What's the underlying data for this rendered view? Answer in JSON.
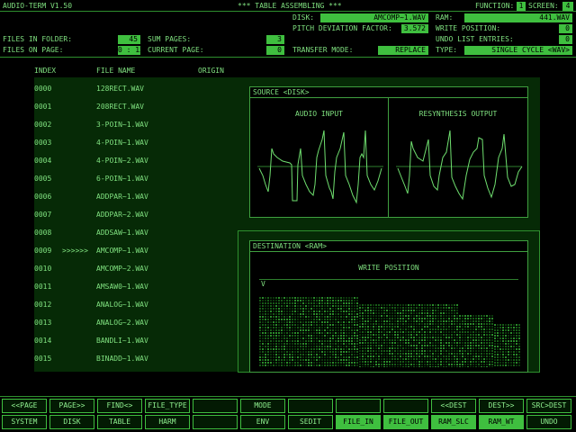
{
  "header": {
    "app_title": "AUDIO-TERM V1.50",
    "screen_title": "*** TABLE ASSEMBLING ***",
    "function_label": "FUNCTION:",
    "function_value": "1",
    "screen_label": "SCREEN:",
    "screen_value": "4"
  },
  "fields": {
    "disk_label": "DISK:",
    "disk_value": "AMCOMP~1.WAV",
    "ram_label": "RAM:",
    "ram_value": "441.WAV",
    "pitch_label": "PITCH DEVIATION FACTOR:",
    "pitch_value": "3.572",
    "write_pos_label": "WRITE POSITION:",
    "write_pos_value": "0",
    "files_folder_label": "FILES IN FOLDER:",
    "files_folder_value": "45",
    "sum_pages_label": "SUM PAGES:",
    "sum_pages_value": "3",
    "undo_label": "UNDO LIST ENTRIES:",
    "undo_value": "0",
    "files_page_label": "FILES ON PAGE:",
    "files_page_value": "0 : 15",
    "current_page_label": "CURRENT PAGE:",
    "current_page_value": "0",
    "transfer_label": "TRANSFER MODE:",
    "transfer_value": "REPLACE",
    "type_label": "TYPE:",
    "type_value": "SINGLE CYCLE <WAV>"
  },
  "list": {
    "headers": {
      "index": "INDEX",
      "file_name": "FILE NAME",
      "origin": "ORIGIN"
    },
    "marker": ">>>>>>",
    "selected_row": 9,
    "rows": [
      {
        "index": "0000",
        "name": "128RECT.WAV"
      },
      {
        "index": "0001",
        "name": "208RECT.WAV"
      },
      {
        "index": "0002",
        "name": "3-POIN~1.WAV"
      },
      {
        "index": "0003",
        "name": "4-POIN~1.WAV"
      },
      {
        "index": "0004",
        "name": "4-POIN~2.WAV"
      },
      {
        "index": "0005",
        "name": "6-POIN~1.WAV"
      },
      {
        "index": "0006",
        "name": "ADDPAR~1.WAV"
      },
      {
        "index": "0007",
        "name": "ADDPAR~2.WAV"
      },
      {
        "index": "0008",
        "name": "ADDSAW~1.WAV"
      },
      {
        "index": "0009",
        "name": "AMCOMP~1.WAV"
      },
      {
        "index": "0010",
        "name": "AMCOMP~2.WAV"
      },
      {
        "index": "0011",
        "name": "AMSAW0~1.WAV"
      },
      {
        "index": "0012",
        "name": "ANALOG~1.WAV"
      },
      {
        "index": "0013",
        "name": "ANALOG~2.WAV"
      },
      {
        "index": "0014",
        "name": "BANDLI~1.WAV"
      },
      {
        "index": "0015",
        "name": "BINADD~1.WAV"
      }
    ]
  },
  "source_panel": {
    "title": "SOURCE <DISK>",
    "audio_input": "AUDIO INPUT",
    "resynthesis_output": "RESYNTHESIS OUTPUT"
  },
  "dest_panel": {
    "title": "DESTINATION <RAM>",
    "write_position": "WRITE POSITION",
    "cursor": "V"
  },
  "buttons_row1": [
    {
      "label": "<<PAGE",
      "active": false
    },
    {
      "label": "PAGE>>",
      "active": false
    },
    {
      "label": "FIND<>",
      "active": false
    },
    {
      "label": "FILE_TYPE",
      "active": false
    },
    {
      "label": "",
      "active": false
    },
    {
      "label": "MODE",
      "active": false
    },
    {
      "label": "",
      "active": false
    },
    {
      "label": "",
      "active": false
    },
    {
      "label": "",
      "active": false
    },
    {
      "label": "<<DEST",
      "active": false
    },
    {
      "label": "DEST>>",
      "active": false
    },
    {
      "label": "SRC>DEST",
      "active": false
    }
  ],
  "buttons_row2": [
    {
      "label": "SYSTEM",
      "active": false
    },
    {
      "label": "DISK",
      "active": false
    },
    {
      "label": "TABLE",
      "active": false
    },
    {
      "label": "HARM",
      "active": false
    },
    {
      "label": "",
      "active": false
    },
    {
      "label": "ENV",
      "active": false
    },
    {
      "label": "SEDIT",
      "active": false
    },
    {
      "label": "FILE_IN",
      "active": true
    },
    {
      "label": "FILE_OUT",
      "active": true
    },
    {
      "label": "RAM_SLC",
      "active": true
    },
    {
      "label": "RAM_WT",
      "active": true
    },
    {
      "label": "UNDO",
      "active": false
    }
  ],
  "colors": {
    "background": "#000000",
    "text": "#7fe07f",
    "value_fill": "#3fbf3f",
    "panel": "#062a06",
    "border": "#3f9f3f"
  }
}
